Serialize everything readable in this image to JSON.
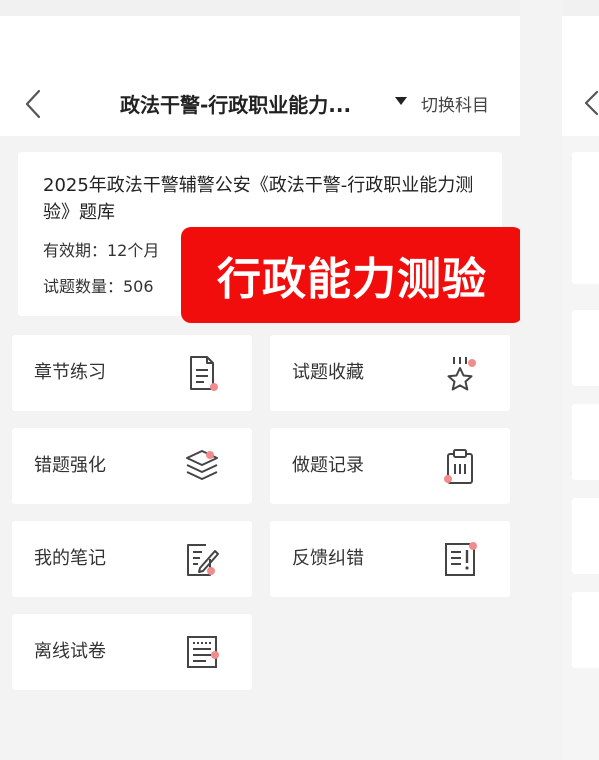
{
  "header": {
    "title": "政法干警-行政职业能力...",
    "switch_label": "切换科目"
  },
  "info": {
    "title": "2025年政法干警辅警公安《政法干警-行政职业能力测验》题库",
    "validity": "有效期：12个月",
    "question_count": "试题数量：506"
  },
  "overlay": {
    "text": "行政能力测验"
  },
  "tiles": [
    {
      "label": "章节练习",
      "icon": "document-icon"
    },
    {
      "label": "试题收藏",
      "icon": "star-icon"
    },
    {
      "label": "错题强化",
      "icon": "layers-icon"
    },
    {
      "label": "做题记录",
      "icon": "clipboard-icon"
    },
    {
      "label": "我的笔记",
      "icon": "note-edit-icon"
    },
    {
      "label": "反馈纠错",
      "icon": "feedback-icon"
    },
    {
      "label": "离线试卷",
      "icon": "offline-paper-icon"
    }
  ],
  "colors": {
    "accent_red": "#f20d0d",
    "icon_dot": "#f28b8b",
    "icon_stroke": "#444444"
  }
}
